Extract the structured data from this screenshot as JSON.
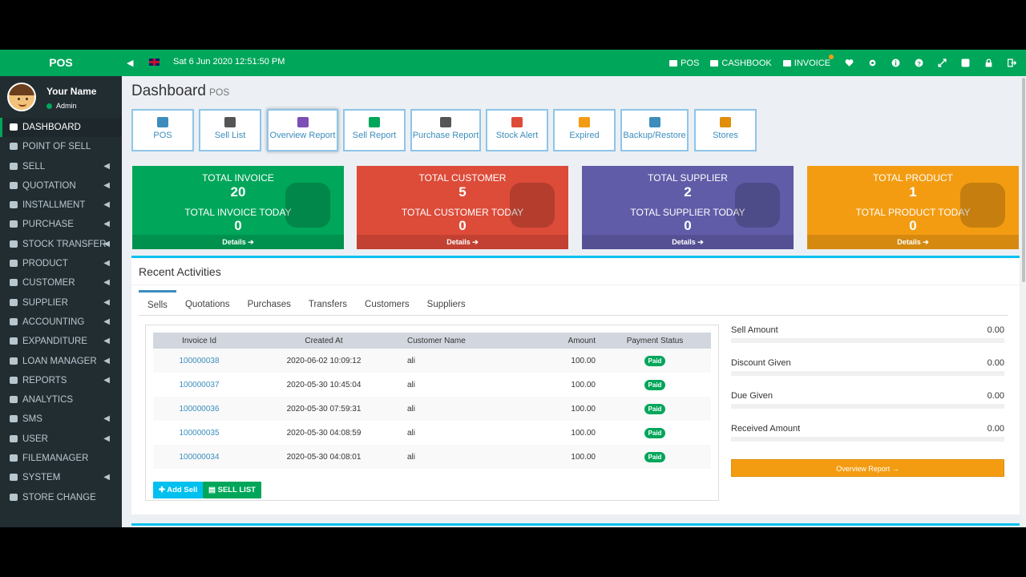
{
  "sidebar": {
    "brand": "POS",
    "user_name": "Your Name",
    "user_role": "Admin",
    "items": [
      {
        "label": "DASHBOARD",
        "icon": "dashboard-icon",
        "caret": false
      },
      {
        "label": "POINT OF SELL",
        "icon": "pos-icon",
        "caret": false
      },
      {
        "label": "SELL",
        "icon": "cart-icon",
        "caret": true
      },
      {
        "label": "QUOTATION",
        "icon": "heart-icon",
        "caret": true
      },
      {
        "label": "INSTALLMENT",
        "icon": "calendar-icon",
        "caret": true
      },
      {
        "label": "PURCHASE",
        "icon": "truck-icon",
        "caret": true
      },
      {
        "label": "STOCK TRANSFER",
        "icon": "transfer-icon",
        "caret": true
      },
      {
        "label": "PRODUCT",
        "icon": "star-icon",
        "caret": true
      },
      {
        "label": "CUSTOMER",
        "icon": "users-icon",
        "caret": true
      },
      {
        "label": "SUPPLIER",
        "icon": "supplier-icon",
        "caret": true
      },
      {
        "label": "ACCOUNTING",
        "icon": "bank-icon",
        "caret": true
      },
      {
        "label": "EXPANDITURE",
        "icon": "minus-icon",
        "caret": true
      },
      {
        "label": "LOAN MANAGER",
        "icon": "money-icon",
        "caret": true
      },
      {
        "label": "REPORTS",
        "icon": "chart-icon",
        "caret": true
      },
      {
        "label": "ANALYTICS",
        "icon": "analytics-icon",
        "caret": false
      },
      {
        "label": "SMS",
        "icon": "sms-icon",
        "caret": true
      },
      {
        "label": "USER",
        "icon": "user-icon",
        "caret": true
      },
      {
        "label": "FILEMANAGER",
        "icon": "folder-icon",
        "caret": false
      },
      {
        "label": "SYSTEM",
        "icon": "gear-icon",
        "caret": true
      },
      {
        "label": "STORE CHANGE",
        "icon": "grid-icon",
        "caret": false
      }
    ]
  },
  "topbar": {
    "datetime": "Sat 6 Jun 2020 12:51:50 PM",
    "nav": [
      {
        "label": "POS",
        "icon": "pos-icon"
      },
      {
        "label": "CASHBOOK",
        "icon": "book-icon"
      },
      {
        "label": "INVOICE",
        "icon": "list-icon"
      }
    ]
  },
  "page": {
    "title": "Dashboard",
    "subtitle": "POS"
  },
  "quick_buttons": [
    {
      "label": "POS",
      "icon": "cart-icon",
      "color": "#3c8dbc"
    },
    {
      "label": "Sell List",
      "icon": "receipt-icon",
      "color": "#555555"
    },
    {
      "label": "Overview Report",
      "icon": "flag-icon",
      "color": "#7b4fb5"
    },
    {
      "label": "Sell Report",
      "icon": "money-icon",
      "color": "#00a65a"
    },
    {
      "label": "Purchase Report",
      "icon": "doc-icon",
      "color": "#555555"
    },
    {
      "label": "Stock Alert",
      "icon": "megaphone-icon",
      "color": "#dd4b39"
    },
    {
      "label": "Expired",
      "icon": "bell-icon",
      "color": "#f39c12"
    },
    {
      "label": "Backup/Restore",
      "icon": "database-icon",
      "color": "#3c8dbc"
    },
    {
      "label": "Stores",
      "icon": "store-icon",
      "color": "#e08e0b"
    }
  ],
  "tiles": [
    {
      "title": "TOTAL INVOICE",
      "value": "20",
      "title2": "TOTAL INVOICE TODAY",
      "value2": "0",
      "footer": "Details",
      "color": "#00a65a",
      "icon": "pencil-icon"
    },
    {
      "title": "TOTAL CUSTOMER",
      "value": "5",
      "title2": "TOTAL CUSTOMER TODAY",
      "value2": "0",
      "footer": "Details",
      "color": "#dd4b39",
      "icon": "users-icon"
    },
    {
      "title": "TOTAL SUPPLIER",
      "value": "2",
      "title2": "TOTAL SUPPLIER TODAY",
      "value2": "0",
      "footer": "Details",
      "color": "#605ca8",
      "icon": "cart-icon"
    },
    {
      "title": "TOTAL PRODUCT",
      "value": "1",
      "title2": "TOTAL PRODUCT TODAY",
      "value2": "0",
      "footer": "Details",
      "color": "#f39c12",
      "icon": "star-icon"
    }
  ],
  "recent": {
    "title": "Recent Activities",
    "tabs": [
      "Sells",
      "Quotations",
      "Purchases",
      "Transfers",
      "Customers",
      "Suppliers"
    ],
    "columns": [
      "Invoice Id",
      "Created At",
      "Customer Name",
      "Amount",
      "Payment Status"
    ],
    "rows": [
      {
        "invoice": "100000038",
        "created": "2020-06-02 10:09:12",
        "customer": "ali",
        "amount": "100.00",
        "status": "Paid"
      },
      {
        "invoice": "100000037",
        "created": "2020-05-30 10:45:04",
        "customer": "ali",
        "amount": "100.00",
        "status": "Paid"
      },
      {
        "invoice": "100000036",
        "created": "2020-05-30 07:59:31",
        "customer": "ali",
        "amount": "100.00",
        "status": "Paid"
      },
      {
        "invoice": "100000035",
        "created": "2020-05-30 04:08:59",
        "customer": "ali",
        "amount": "100.00",
        "status": "Paid"
      },
      {
        "invoice": "100000034",
        "created": "2020-05-30 04:08:01",
        "customer": "ali",
        "amount": "100.00",
        "status": "Paid"
      }
    ],
    "add_sell_label": "Add Sell",
    "sell_list_label": "SELL LIST",
    "summary": [
      {
        "label": "Sell Amount",
        "value": "0.00"
      },
      {
        "label": "Discount Given",
        "value": "0.00"
      },
      {
        "label": "Due Given",
        "value": "0.00"
      },
      {
        "label": "Received Amount",
        "value": "0.00"
      }
    ],
    "overview_label": "Overview Report →"
  }
}
